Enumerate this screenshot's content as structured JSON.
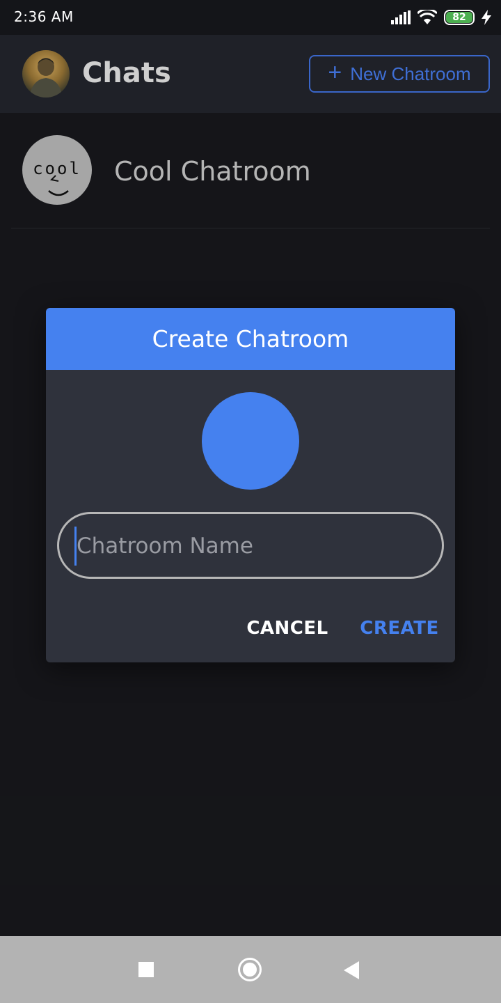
{
  "status_bar": {
    "time": "2:36 AM",
    "battery_level": "82",
    "icons": [
      "signal-icon",
      "wifi-icon",
      "battery-icon",
      "charging-icon"
    ]
  },
  "header": {
    "title": "Chats",
    "new_chatroom_label": "New Chatroom",
    "accent_color": "#3f6fd6"
  },
  "chat_list": [
    {
      "name": "Cool Chatroom",
      "avatar_text": "cool"
    }
  ],
  "dialog": {
    "title": "Create Chatroom",
    "input_placeholder": "Chatroom Name",
    "input_value": "",
    "cancel_label": "CANCEL",
    "create_label": "CREATE",
    "accent_color": "#4581ef"
  },
  "nav_bar": {
    "icons": [
      "recents-icon",
      "home-icon",
      "back-icon"
    ]
  }
}
